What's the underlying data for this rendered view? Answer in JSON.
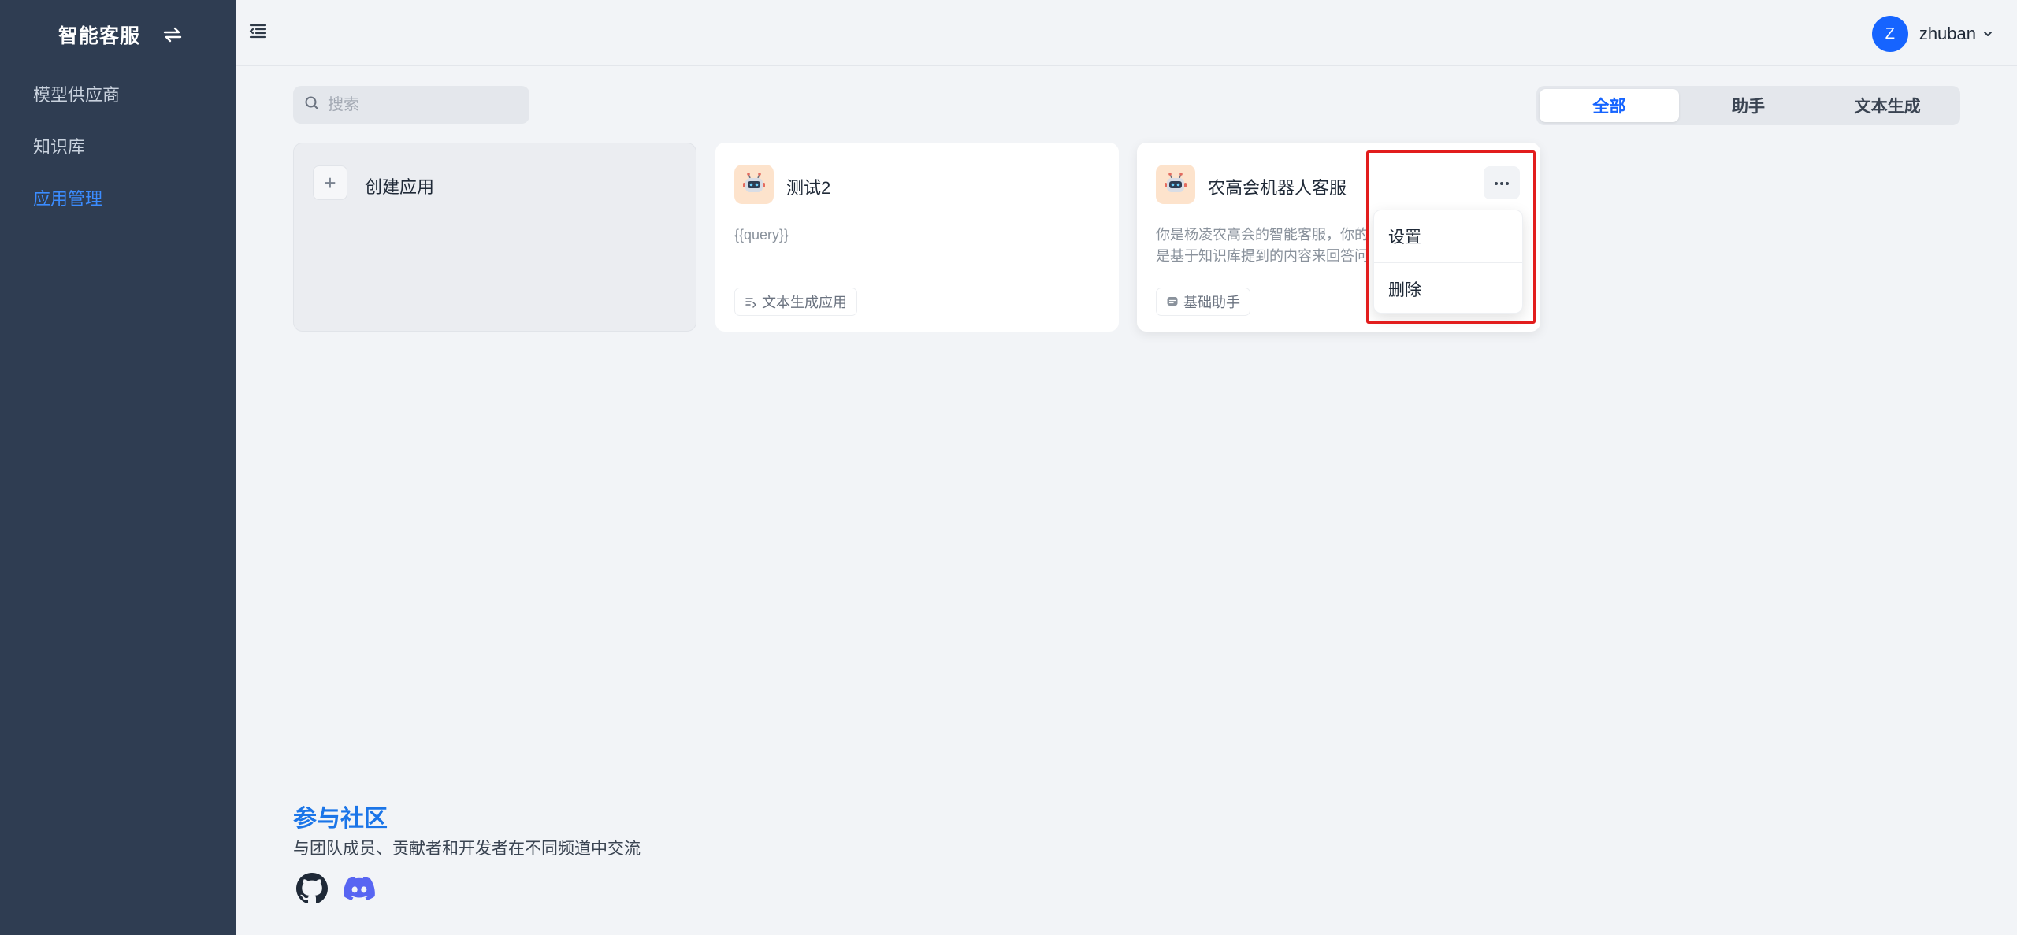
{
  "brand": {
    "title": "智能客服",
    "switch_icon": "swap-icon"
  },
  "sidebar": {
    "items": [
      {
        "label": "模型供应商",
        "active": false
      },
      {
        "label": "知识库",
        "active": false
      },
      {
        "label": "应用管理",
        "active": true
      }
    ],
    "active_color": "#3b8cff"
  },
  "header": {
    "user": {
      "initial": "Z",
      "name": "zhuban"
    }
  },
  "search": {
    "placeholder": "搜索",
    "value": ""
  },
  "filters": {
    "tabs": [
      {
        "label": "全部",
        "active": true
      },
      {
        "label": "助手",
        "active": false
      },
      {
        "label": "文本生成",
        "active": false
      }
    ]
  },
  "create_card": {
    "plus": "+",
    "label": "创建应用"
  },
  "apps": [
    {
      "name": "测试2",
      "description": "{{query}}",
      "tag": "文本生成应用",
      "tag_icon": "text-generation-icon",
      "icon": "robot-icon"
    },
    {
      "name": "农高会机器人客服",
      "description": "你是杨凌农高会的智能客服，你的\n是基于知识库提到的内容来回答问",
      "tag": "基础助手",
      "tag_icon": "chat-bubble-icon",
      "icon": "robot-icon"
    }
  ],
  "dropdown": {
    "items": [
      {
        "label": "设置"
      },
      {
        "label": "删除"
      }
    ]
  },
  "community": {
    "title": "参与社区",
    "description": "与团队成员、贡献者和开发者在不同频道中交流",
    "links": [
      "github-icon",
      "discord-icon"
    ]
  },
  "colors": {
    "sidebar_bg": "#2f3d52",
    "primary": "#1664ff",
    "community_title": "#1b75e8",
    "highlight": "#e21d1d"
  }
}
